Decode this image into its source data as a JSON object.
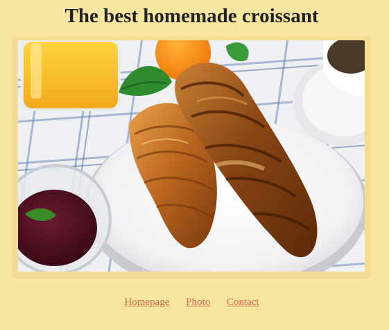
{
  "page": {
    "title": "The best homemade croissant"
  },
  "photo": {
    "subject": "croissants-breakfast-photo"
  },
  "nav": {
    "links": [
      {
        "label": "Homepage"
      },
      {
        "label": "Photo"
      },
      {
        "label": "Contact"
      }
    ]
  },
  "colors": {
    "background": "#f8e6a0",
    "link": "#d4674d",
    "title": "#222222"
  }
}
